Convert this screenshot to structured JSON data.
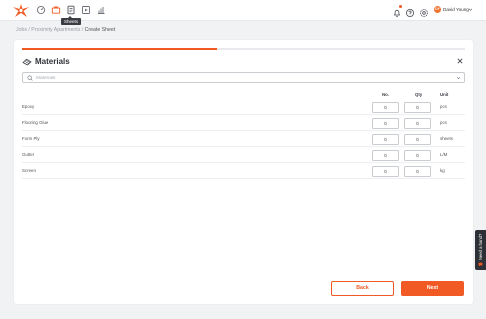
{
  "nav": {
    "icons": [
      "logo",
      "dashboard-icon",
      "jobs-icon",
      "sheets-icon",
      "media-icon",
      "reports-icon"
    ],
    "tooltip": "Sheets"
  },
  "header_right": {
    "icons": [
      "bell-icon",
      "help-icon",
      "settings-icon"
    ],
    "user_initials": "DY",
    "user_name": "David Young"
  },
  "breadcrumb": {
    "items": [
      "Jobs",
      "Proximity Apartments"
    ],
    "separator": " / ",
    "current": "Create Sheet"
  },
  "progress": {
    "value": 0.44
  },
  "dialog": {
    "title": "Materials",
    "search": {
      "value": "",
      "placeholder": "Materials"
    },
    "columns": {
      "no": "No.",
      "qty": "Qty",
      "unit": "Unit"
    },
    "rows": [
      {
        "name": "Epoxy",
        "no": "0",
        "qty": "0",
        "unit": "pcs"
      },
      {
        "name": "Flooring Glue",
        "no": "0",
        "qty": "0",
        "unit": "pcs"
      },
      {
        "name": "Form Ply",
        "no": "0",
        "qty": "0",
        "unit": "sheets"
      },
      {
        "name": "Gutter",
        "no": "0",
        "qty": "0",
        "unit": "L/M"
      },
      {
        "name": "Screen",
        "no": "0",
        "qty": "0",
        "unit": "kg"
      }
    ],
    "back_label": "Back",
    "next_label": "Next"
  },
  "help_tab": {
    "label": "Need a hand?"
  },
  "colors": {
    "accent": "#f15a24",
    "dark": "#2d3036",
    "background": "#f1f2f4"
  }
}
